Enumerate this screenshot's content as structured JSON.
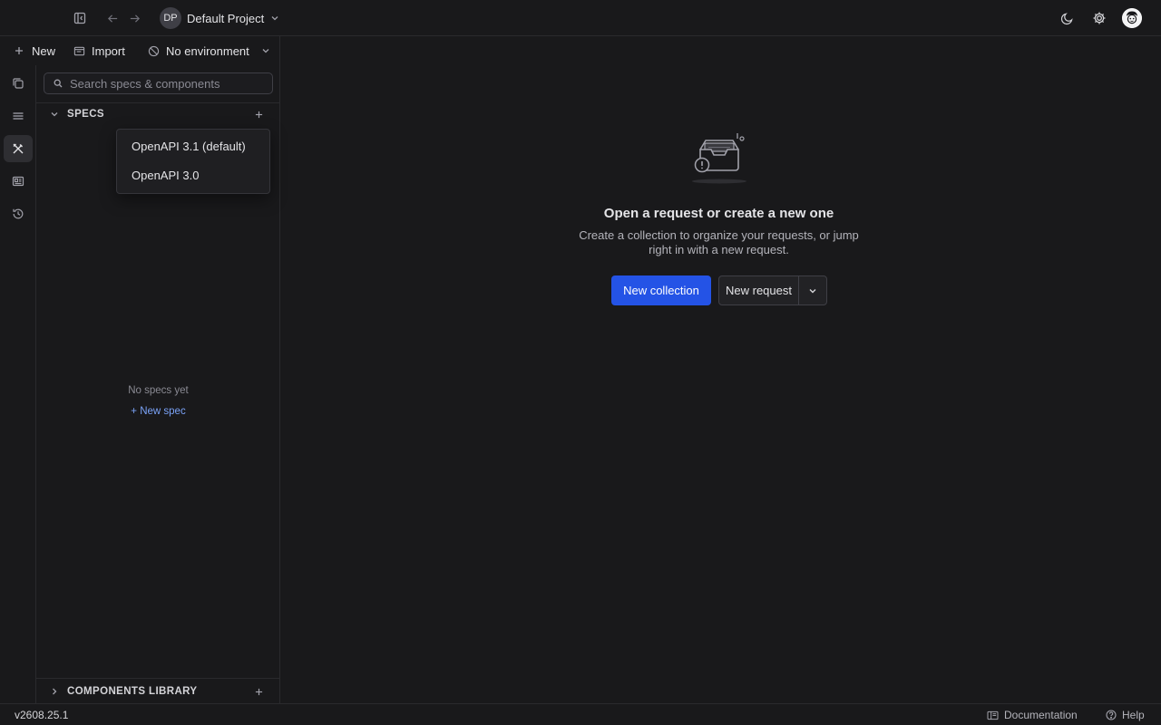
{
  "header": {
    "project_initials": "DP",
    "project_name": "Default Project"
  },
  "toolbar": {
    "new_label": "New",
    "import_label": "Import",
    "environment_label": "No environment"
  },
  "sidebar": {
    "search_placeholder": "Search specs & components",
    "specs_section": "SPECS",
    "components_section": "COMPONENTS LIBRARY",
    "empty_text": "No specs yet",
    "new_spec_link": "+ New spec"
  },
  "spec_menu": {
    "options": [
      "OpenAPI 3.1 (default)",
      "OpenAPI 3.0"
    ]
  },
  "empty_state": {
    "title": "Open a request or create a new one",
    "description": "Create a collection to organize your requests, or jump right in with a new request.",
    "primary_button": "New collection",
    "secondary_button": "New request"
  },
  "status": {
    "version": "v2608.25.1",
    "documentation": "Documentation",
    "help": "Help"
  },
  "colors": {
    "background": "#19191b",
    "accent": "#2453e6",
    "link": "#7aa2f7",
    "border": "#2a2a2d"
  },
  "icons": [
    "sidebar-toggle-icon",
    "arrow-left-icon",
    "arrow-right-icon",
    "chevron-down-icon",
    "moon-icon",
    "gear-icon",
    "user-avatar-icon",
    "plus-icon",
    "import-icon",
    "no-environment-icon",
    "collections-icon",
    "layers-icon",
    "tools-icon",
    "newspaper-icon",
    "history-icon",
    "search-icon",
    "chevron-right-icon",
    "book-icon",
    "help-circle-icon"
  ]
}
